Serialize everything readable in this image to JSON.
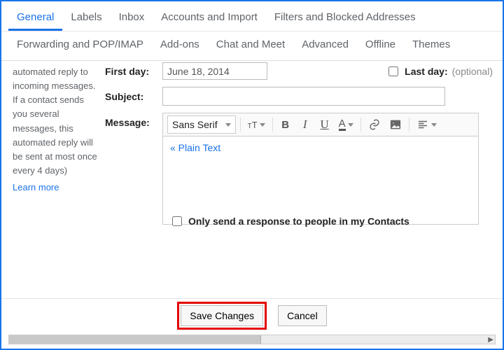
{
  "tabs": {
    "row1": [
      "General",
      "Labels",
      "Inbox",
      "Accounts and Import",
      "Filters and Blocked Addresses"
    ],
    "row2": [
      "Forwarding and POP/IMAP",
      "Add-ons",
      "Chat and Meet",
      "Advanced",
      "Offline",
      "Themes"
    ],
    "active": "General"
  },
  "sidebar": {
    "desc": "automated reply to incoming messages. If a contact sends you several messages, this automated reply will be sent at most once every 4 days)",
    "learn": "Learn more"
  },
  "form": {
    "first_day_label": "First day:",
    "first_day_value": "June 18, 2014",
    "last_day_label": "Last day:",
    "last_day_optional": "(optional)",
    "subject_label": "Subject:",
    "subject_value": "",
    "message_label": "Message:",
    "font_name": "Sans Serif",
    "plain_text": "« Plain Text",
    "only_contacts_label": "Only send a response to people in my Contacts"
  },
  "buttons": {
    "save": "Save Changes",
    "cancel": "Cancel"
  }
}
